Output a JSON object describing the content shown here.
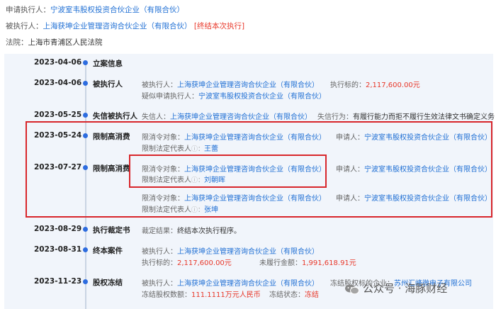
{
  "header": {
    "applicant_label": "申请执行人：",
    "applicant_value": "宁波室韦股权投资合伙企业（有限合伙）",
    "executee_label": "被执行人：",
    "executee_value": "上海获坤企业管理咨询合伙企业（有限合伙）",
    "executee_status": "[终结本次执行]",
    "court_label": "法院：",
    "court_value": "上海市青浦区人民法院"
  },
  "timeline": {
    "e1": {
      "date": "2023-04-06",
      "cat": "立案信息"
    },
    "e2": {
      "date": "2023-04-06",
      "cat": "被执行人",
      "l1_label": "被执行人：",
      "l1_value": "上海获坤企业管理咨询合伙企业（有限合伙）",
      "l1b_label": "执行标的：",
      "l1b_value": "2,117,600.00元",
      "l2_label": "疑似申请执行人：",
      "l2_value": "宁波室韦股权投资合伙企业（有限合伙）"
    },
    "e3": {
      "date": "2023-05-25",
      "cat": "失信被执行人",
      "l1_label": "失信人：",
      "l1_value": "上海获坤企业管理咨询合伙企业（有限合伙）",
      "l1b_label": "失信行为：",
      "l1b_value": "有履行能力而拒不履行生效法律文书确定义务"
    },
    "e4": {
      "date": "2023-05-24",
      "cat": "限制高消费",
      "l1_label": "限消令对象：",
      "l1_value": "上海获坤企业管理咨询合伙企业（有限合伙）",
      "l1b_label": "申请人：",
      "l1b_value": "宁波室韦股权投资合伙企业（有限合伙）",
      "l2_label": "限制法定代表人",
      "l2_value": "王蕾"
    },
    "e5": {
      "date": "2023-07-27",
      "cat": "限制高消费",
      "l1_label": "限消令对象：",
      "l1_value": "上海获坤企业管理咨询合伙企业（有限合伙）",
      "l1b_label": "申请人：",
      "l1b_value": "宁波室韦股权投资合伙企业（有限合伙）",
      "l2_label": "限制法定代表人",
      "l2_value": "刘朝晖",
      "l3_label": "限消令对象：",
      "l3_value": "上海获坤企业管理咨询合伙企业（有限合伙）",
      "l3b_label": "申请人：",
      "l3b_value": "宁波室韦股权投资合伙企业（有限合伙）",
      "l4_label": "限制法定代表人",
      "l4_value": "张坤"
    },
    "e6": {
      "date": "2023-08-29",
      "cat": "执行裁定书",
      "l1_label": "裁定结果：",
      "l1_value": "终结本次执行程序。"
    },
    "e7": {
      "date": "2023-08-31",
      "cat": "终本案件",
      "l1_label": "被执行人：",
      "l1_value": "上海获坤企业管理咨询合伙企业（有限合伙）",
      "l2_label": "执行标的：",
      "l2_value": "2,117,600.00元",
      "l2b_label": "未履行金额：",
      "l2b_value": "1,991,618.91元"
    },
    "e8": {
      "date": "2023-11-23",
      "cat": "股权冻结",
      "l1_label": "被执行人：",
      "l1_value": "上海获坤企业管理咨询合伙企业（有限合伙）",
      "l1b_label": "冻结股权标的企业：",
      "l1b_value": "苏州汇峰微电子有限公司",
      "l2_label": "冻结股权数额：",
      "l2_value": "111.1111万元人民币",
      "l2b_label": "冻结状态：",
      "l2b_value": "冻结"
    }
  },
  "info_glyph": "ⓘ：",
  "watermark": {
    "text": "公众号 · 海豚财经",
    "icon": "wechat-icon"
  }
}
